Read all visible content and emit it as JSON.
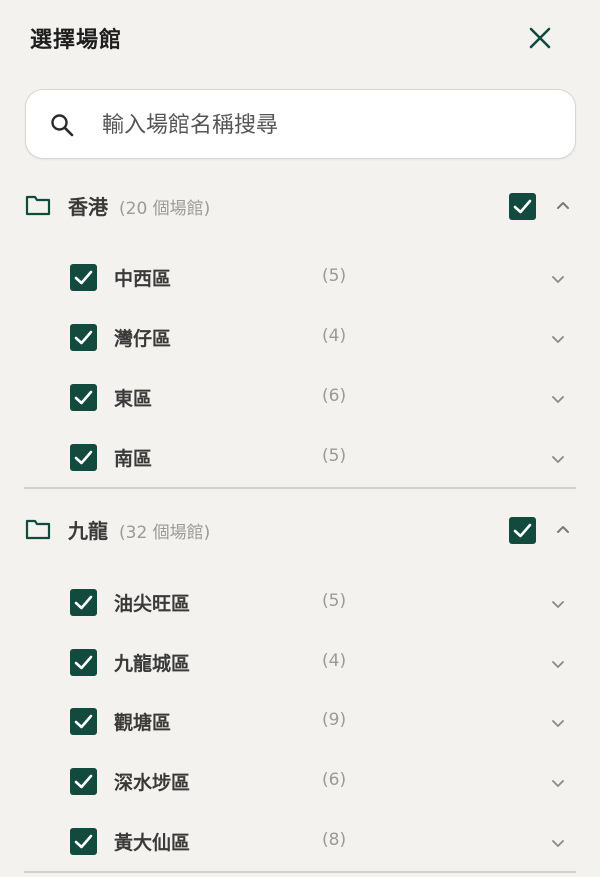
{
  "header": {
    "title": "選擇場館"
  },
  "search": {
    "placeholder": "輸入場館名稱搜尋"
  },
  "groups": [
    {
      "name": "香港",
      "count": "(20 個場館)",
      "checked": true,
      "expanded": true,
      "districts": [
        {
          "name": "中西區",
          "count": "(5)",
          "checked": true
        },
        {
          "name": "灣仔區",
          "count": "(4)",
          "checked": true
        },
        {
          "name": "東區",
          "count": "(6)",
          "checked": true
        },
        {
          "name": "南區",
          "count": "(5)",
          "checked": true
        }
      ]
    },
    {
      "name": "九龍",
      "count": "(32 個場館)",
      "checked": true,
      "expanded": true,
      "districts": [
        {
          "name": "油尖旺區",
          "count": "(5)",
          "checked": true
        },
        {
          "name": "九龍城區",
          "count": "(4)",
          "checked": true
        },
        {
          "name": "觀塘區",
          "count": "(9)",
          "checked": true
        },
        {
          "name": "深水埗區",
          "count": "(6)",
          "checked": true
        },
        {
          "name": "黃大仙區",
          "count": "(8)",
          "checked": true
        }
      ]
    }
  ],
  "colors": {
    "accent": "#124a3e",
    "background": "#f3f2ee"
  },
  "icons": {
    "close": "close-icon",
    "search": "search-icon",
    "folder": "folder-icon",
    "checkbox": "check-icon",
    "collapse": "chevron-up-icon",
    "expand": "chevron-down-icon"
  }
}
